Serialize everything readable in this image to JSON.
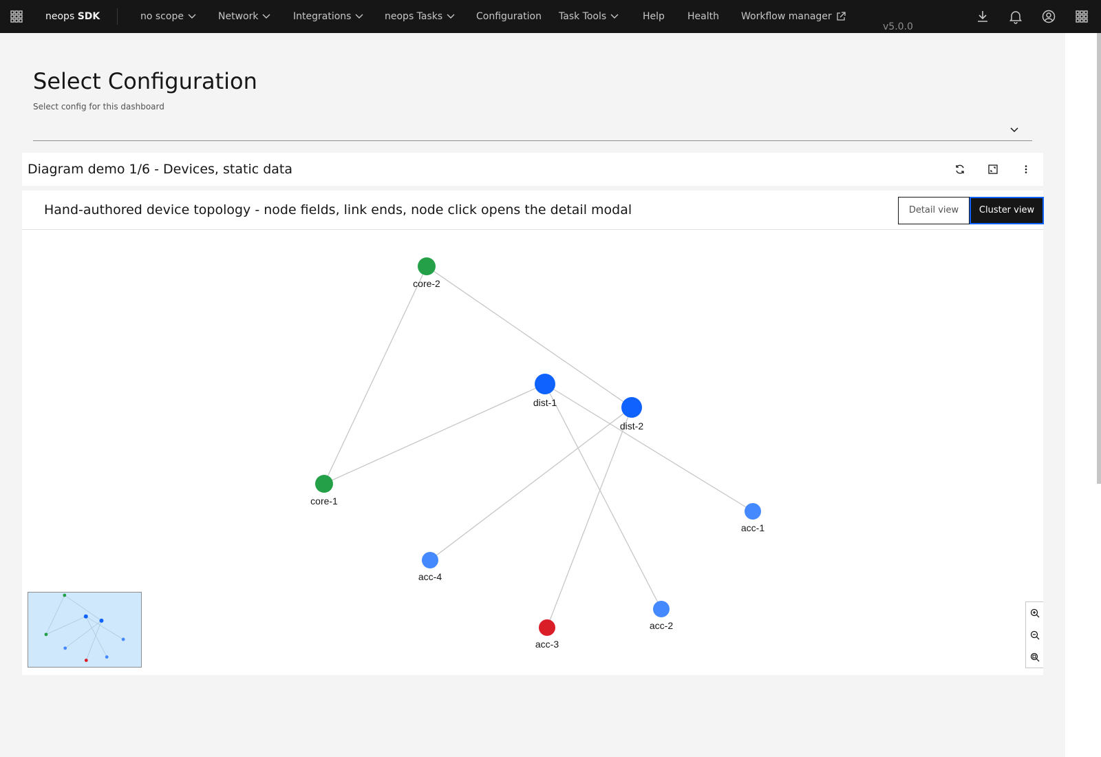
{
  "nav": {
    "brand_light": "neops ",
    "brand_bold": "SDK",
    "items": [
      {
        "label": "no scope",
        "dropdown": true
      },
      {
        "label": "Network",
        "dropdown": true
      },
      {
        "label": "Integrations",
        "dropdown": true
      },
      {
        "label": "neops Tasks",
        "dropdown": true
      },
      {
        "label": "Configuration",
        "dropdown": false
      },
      {
        "label": "Task Tools",
        "dropdown": true
      },
      {
        "label": "Help",
        "dropdown": false
      },
      {
        "label": "Health",
        "dropdown": false
      },
      {
        "label": "Workflow manager",
        "dropdown": false,
        "external": true
      }
    ],
    "version": "v5.0.0",
    "icons": [
      "app-switcher-icon",
      "download-icon",
      "notification-icon",
      "user-avatar-icon",
      "grid-menu-icon"
    ]
  },
  "config": {
    "title": "Select Configuration",
    "subtitle": "Select config for this dashboard",
    "selected_value": ""
  },
  "panel": {
    "title": "Diagram demo 1/6 - Devices, static data",
    "icons": [
      "refresh-icon",
      "maximize-icon",
      "overflow-menu-icon"
    ]
  },
  "diagram": {
    "title": "Hand-authored device topology - node fields, link ends, node click opens the detail modal",
    "view_buttons": {
      "detail": "Detail view",
      "cluster": "Cluster view",
      "active": "cluster"
    },
    "colors": {
      "core": "#24a148",
      "dist": "#0f62fe",
      "acc": "#4589ff",
      "alert": "#da1e28",
      "link": "#c6c6c6",
      "minimap_bg": "#d0e8fb"
    },
    "nodes": [
      {
        "id": "core-2",
        "label": "core-2",
        "role": "core"
      },
      {
        "id": "core-1",
        "label": "core-1",
        "role": "core"
      },
      {
        "id": "dist-1",
        "label": "dist-1",
        "role": "dist"
      },
      {
        "id": "dist-2",
        "label": "dist-2",
        "role": "dist"
      },
      {
        "id": "acc-1",
        "label": "acc-1",
        "role": "acc"
      },
      {
        "id": "acc-2",
        "label": "acc-2",
        "role": "acc"
      },
      {
        "id": "acc-3",
        "label": "acc-3",
        "role": "alert"
      },
      {
        "id": "acc-4",
        "label": "acc-4",
        "role": "acc"
      }
    ],
    "links": [
      [
        "core-2",
        "core-1"
      ],
      [
        "core-2",
        "dist-2"
      ],
      [
        "core-1",
        "dist-1"
      ],
      [
        "dist-1",
        "acc-1"
      ],
      [
        "dist-1",
        "acc-2"
      ],
      [
        "dist-2",
        "acc-4"
      ],
      [
        "dist-2",
        "acc-3"
      ]
    ],
    "zoom_controls": [
      "zoom-in-icon",
      "zoom-out-icon",
      "zoom-fit-icon"
    ]
  }
}
